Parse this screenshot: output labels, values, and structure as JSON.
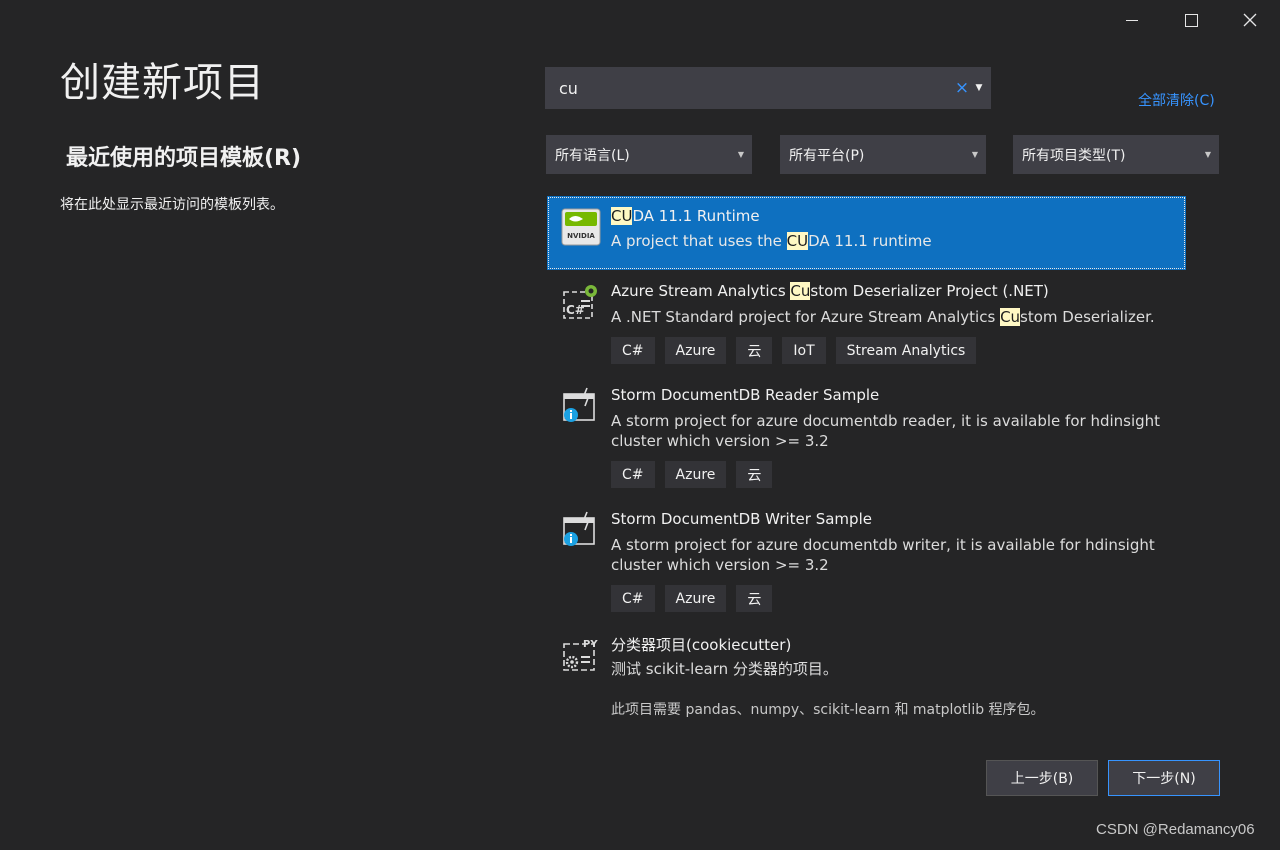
{
  "window": {
    "controls": {
      "minimize": "minimize",
      "maximize": "maximize",
      "close": "close"
    }
  },
  "page": {
    "title": "创建新项目",
    "recent_heading": "最近使用的项目模板(R)",
    "recent_empty_text": "将在此处显示最近访问的模板列表。"
  },
  "search": {
    "value": "cu",
    "clear_glyph": "×"
  },
  "clear_all": "全部清除(C)",
  "filters": {
    "language": "所有语言(L)",
    "platform": "所有平台(P)",
    "project_type": "所有项目类型(T)"
  },
  "templates": [
    {
      "name_hl": "CU",
      "name_rest": "DA 11.1 Runtime",
      "desc_pre": "A project that uses the ",
      "desc_hl": "CU",
      "desc_post": "DA 11.1 runtime",
      "icon": "nvidia-icon"
    },
    {
      "name_pre": "Azure Stream Analytics ",
      "name_hl": "Cu",
      "name_post": "stom Deserializer Project (.NET)",
      "desc_pre": "A .NET Standard project for Azure Stream Analytics ",
      "desc_hl": "Cu",
      "desc_post": "stom Deserializer.",
      "tags": [
        "C#",
        "Azure",
        "云",
        "IoT",
        "Stream Analytics"
      ],
      "icon": "csharp-gear-icon"
    },
    {
      "name": "Storm DocumentDB Reader Sample",
      "desc": "A storm project for azure documentdb reader, it is available for hdinsight cluster which version >= 3.2",
      "tags": [
        "C#",
        "Azure",
        "云"
      ],
      "icon": "storm-info-icon"
    },
    {
      "name": "Storm DocumentDB Writer Sample",
      "desc": "A storm project for azure documentdb writer, it is available for hdinsight cluster which version >= 3.2",
      "tags": [
        "C#",
        "Azure",
        "云"
      ],
      "icon": "storm-info-icon"
    },
    {
      "name": "分类器项目(cookiecutter)",
      "desc": "测试 scikit-learn 分类器的项目。",
      "note": "此项目需要 pandas、numpy、scikit-learn 和 matplotlib 程序包。",
      "icon": "python-gear-icon"
    }
  ],
  "buttons": {
    "prev": "上一步(B)",
    "next": "下一步(N)"
  },
  "watermark": "CSDN @Redamancy06",
  "colors": {
    "background": "#252526",
    "selected": "#0e70c0",
    "accent": "#3794ff",
    "highlight": "#fff8c4"
  }
}
